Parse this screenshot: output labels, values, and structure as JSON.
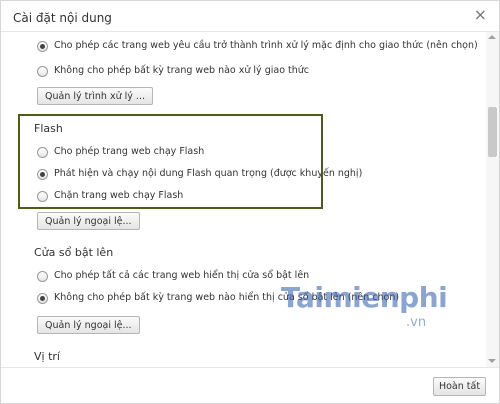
{
  "dialog": {
    "title": "Cài đặt nội dung",
    "close": "×",
    "done_label": "Hoàn tất"
  },
  "handlers": {
    "options": [
      {
        "label": "Cho phép các trang web yêu cầu trở thành trình xử lý mặc định cho giao thức (nên chọn)",
        "selected": true
      },
      {
        "label": "Không cho phép bất kỳ trang web nào xử lý giao thức",
        "selected": false
      }
    ],
    "button": "Quản lý trình xử lý ..."
  },
  "flash": {
    "title": "Flash",
    "options": [
      {
        "label": "Cho phép trang web chạy Flash",
        "selected": false
      },
      {
        "label": "Phát hiện và chạy nội dung Flash quan trọng (được khuyến nghị)",
        "selected": true
      },
      {
        "label": "Chặn trang web chạy Flash",
        "selected": false
      }
    ],
    "button": "Quản lý ngoại lệ..."
  },
  "popups": {
    "title": "Cửa sổ bật lên",
    "options": [
      {
        "label": "Cho phép tất cả các trang web hiển thị cửa sổ bật lên",
        "selected": false
      },
      {
        "label": "Không cho phép bất kỳ trang web nào hiển thị cửa sổ bật lên (nên chọn)",
        "selected": true
      }
    ],
    "button": "Quản lý ngoại lệ..."
  },
  "location": {
    "title": "Vị trí"
  },
  "watermark": {
    "main": "Taimienphi",
    "sub": ".vn"
  }
}
